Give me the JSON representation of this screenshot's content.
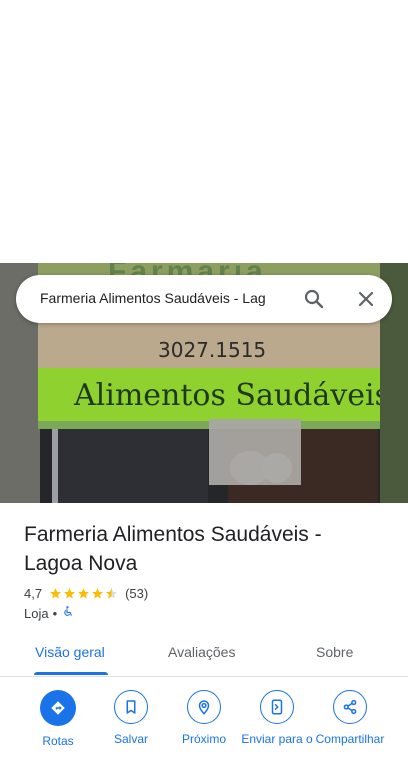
{
  "search": {
    "query": "Farmeria Alimentos Saudáveis - Lag"
  },
  "photo": {
    "phone": "3027.1515",
    "sign": "Alimentos Saudáveis",
    "top_sign": "Farmaria"
  },
  "place": {
    "title": "Farmeria Alimentos Saudáveis - Lagoa Nova",
    "rating": "4,7",
    "stars": 4.7,
    "review_count": "(53)",
    "category": "Loja",
    "separator": "•"
  },
  "tabs": [
    {
      "label": "Visão geral",
      "active": true
    },
    {
      "label": "Avaliações",
      "active": false
    },
    {
      "label": "Sobre",
      "active": false
    }
  ],
  "actions": [
    {
      "label": "Rotas",
      "icon": "directions-icon"
    },
    {
      "label": "Salvar",
      "icon": "bookmark-icon"
    },
    {
      "label": "Próximo",
      "icon": "nearby-icon"
    },
    {
      "label": "Enviar para o",
      "icon": "send-to-phone-icon"
    },
    {
      "label": "Compartilhar",
      "icon": "share-icon"
    }
  ],
  "colors": {
    "accent": "#1a73e8",
    "star": "#fbbc04",
    "sign_green": "#8fd12e"
  }
}
